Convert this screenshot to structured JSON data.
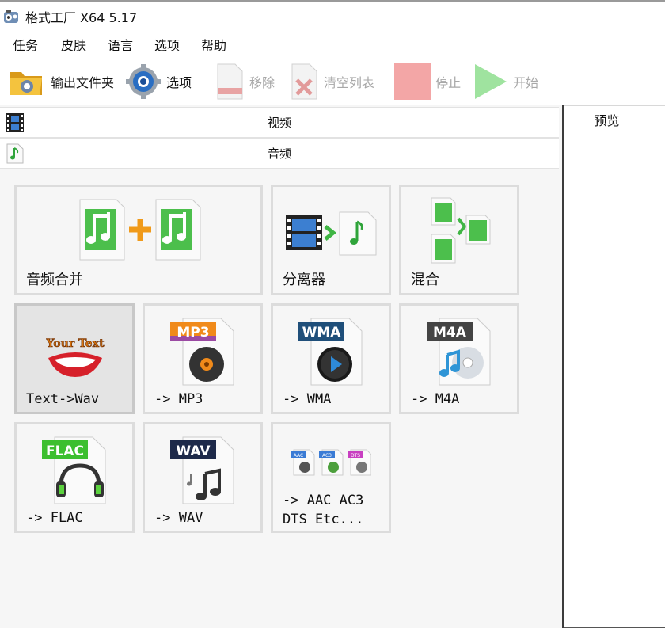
{
  "window": {
    "title": "格式工厂 X64 5.17"
  },
  "menu": {
    "items": [
      "任务",
      "皮肤",
      "语言",
      "选项",
      "帮助"
    ]
  },
  "toolbar": {
    "output_folder": "输出文件夹",
    "options": "选项",
    "remove": "移除",
    "clear_list": "清空列表",
    "stop": "停止",
    "start": "开始"
  },
  "categories": {
    "video": "视频",
    "audio": "音频"
  },
  "tiles": {
    "merge": "音频合并",
    "splitter": "分离器",
    "mix": "混合",
    "text_to_wav": "Text->Wav",
    "mp3": "-> MP3",
    "wma": "-> WMA",
    "m4a": "-> M4A",
    "flac": "-> FLAC",
    "wav": "-> WAV",
    "aac": "-> AAC AC3\nDTS Etc..."
  },
  "badges": {
    "mp3": "MP3",
    "wma": "WMA",
    "m4a": "M4A",
    "flac": "FLAC",
    "wav": "WAV",
    "aac": "AAC",
    "ac3": "AC3",
    "dts": "DTS",
    "your_text": "Your Text"
  },
  "preview": {
    "title": "预览"
  },
  "colors": {
    "note_green": "#3fb544",
    "orange_plus": "#f09a1a",
    "selected_tile": "#e4e4e4"
  }
}
